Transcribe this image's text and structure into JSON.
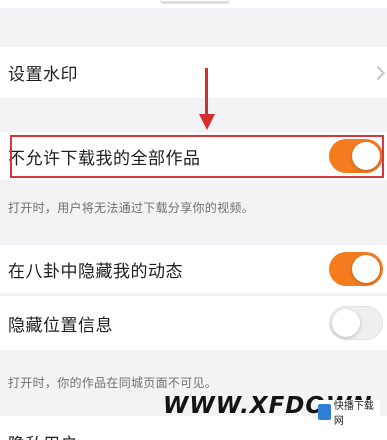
{
  "settings": {
    "watermark_label": "设置水印",
    "disallow_download_label": "不允许下载我的全部作品",
    "disallow_download_enabled": true,
    "disallow_download_hint": "打开时，用户将无法通过下载分享你的视频。",
    "hide_in_bagua_label": "在八卦中隐藏我的动态",
    "hide_in_bagua_enabled": true,
    "hide_location_label": "隐藏位置信息",
    "hide_location_enabled": false,
    "hide_location_hint": "打开时，你的作品在同城页面不可见。",
    "privacy_user_label": "隐私用户"
  },
  "overlay": {
    "watermark_text": "WWW.XFDOWN",
    "logo_text": "快播下载网",
    "annotation_color": "#d32f2f"
  },
  "colors": {
    "toggle_on": "#f47b1e",
    "toggle_off": "#efeff0",
    "background": "#f3f3f5"
  },
  "icons": {
    "row_chevron": "chevron-right-icon"
  }
}
